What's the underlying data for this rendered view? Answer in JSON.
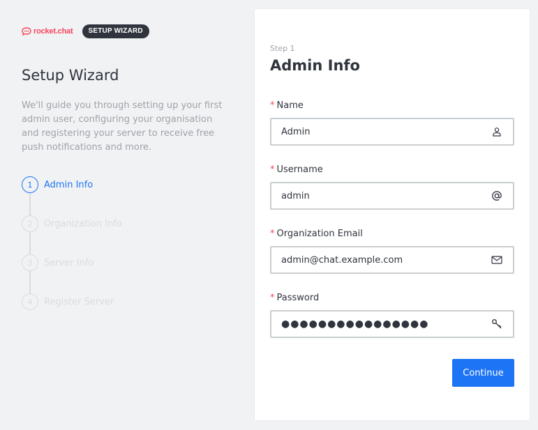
{
  "brand": {
    "logo_text": "rocket.chat",
    "badge": "SETUP WIZARD"
  },
  "sidebar": {
    "title": "Setup Wizard",
    "description": "We'll guide you through setting up your first admin user, configuring your organisation and registering your server to receive free push notifications and more.",
    "steps": [
      {
        "number": "1",
        "label": "Admin Info",
        "active": true
      },
      {
        "number": "2",
        "label": "Organization Info",
        "active": false
      },
      {
        "number": "3",
        "label": "Server Info",
        "active": false
      },
      {
        "number": "4",
        "label": "Register Server",
        "active": false
      }
    ]
  },
  "form": {
    "step_caption": "Step 1",
    "title": "Admin Info",
    "required_marker": "*",
    "fields": [
      {
        "label": "Name",
        "value": "Admin",
        "icon": "user-icon"
      },
      {
        "label": "Username",
        "value": "admin",
        "icon": "at-icon"
      },
      {
        "label": "Organization Email",
        "value": "admin@chat.example.com",
        "icon": "mail-icon"
      },
      {
        "label": "Password",
        "value": "●●●●●●●●●●●●●●●●",
        "icon": "key-icon"
      }
    ],
    "continue_label": "Continue"
  },
  "colors": {
    "accent": "#1d74f5",
    "brand_red": "#f5455c",
    "badge_bg": "#2f343d",
    "muted": "#9ea2a8",
    "disabled": "#d9dbde"
  }
}
